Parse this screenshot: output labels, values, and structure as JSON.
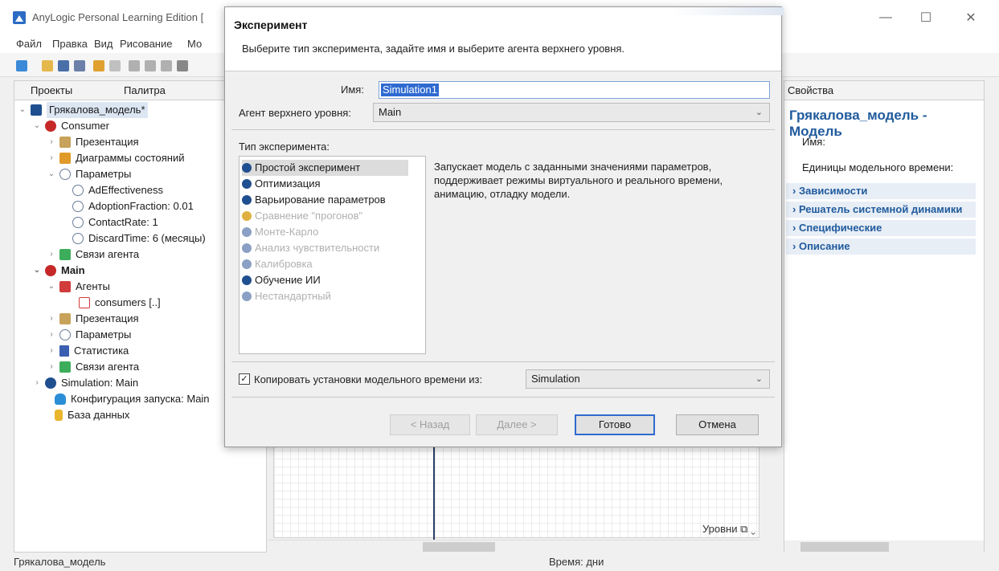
{
  "window": {
    "title": "AnyLogic Personal Learning Edition ["
  },
  "menu": [
    "Файл",
    "Правка",
    "Вид",
    "Рисование",
    "Мо"
  ],
  "left_panel": {
    "tabs": [
      "Проекты",
      "Палитра"
    ],
    "tree": [
      "Грякалова_модель*",
      "Consumer",
      "Презентация",
      "Диаграммы состояний",
      "Параметры",
      "AdEffectiveness",
      "AdoptionFraction: 0.01",
      "ContactRate: 1",
      "DiscardTime: 6 (месяцы)",
      "Связи агента",
      "Main",
      "Агенты",
      "consumers [..]",
      "Презентация",
      "Параметры",
      "Статистика",
      "Связи агента",
      "Simulation: Main",
      "Конфигурация запуска: Main",
      "База данных"
    ]
  },
  "canvas": {
    "levels_label": "Уровни"
  },
  "status": {
    "left": "Грякалова_модель",
    "time": "Время: дни"
  },
  "right_panel": {
    "tab": "Свойства",
    "title": "Грякалова_модель - Модель",
    "fields": [
      "Имя:",
      "Единицы модельного времени:"
    ],
    "sections": [
      "Зависимости",
      "Решатель системной динамики",
      "Специфические",
      "Описание"
    ]
  },
  "dialog": {
    "title": "Эксперимент",
    "subtitle": "Выберите тип эксперимента, задайте имя и выберите агента верхнего уровня.",
    "name_label": "Имя:",
    "name_value": "Simulation1",
    "agent_label": "Агент верхнего уровня:",
    "agent_value": "Main",
    "type_label": "Тип эксперимента:",
    "experiments": [
      "Простой эксперимент",
      "Оптимизация",
      "Варьирование параметров",
      "Сравнение \"прогонов\"",
      "Монте-Карло",
      "Анализ чувствительности",
      "Калибровка",
      "Обучение ИИ",
      "Нестандартный"
    ],
    "description": "Запускает модель с заданными значениями параметров, поддерживает режимы виртуального и реального времени, анимацию, отладку модели.",
    "copy_label": "Копировать установки модельного времени из:",
    "copy_value": "Simulation",
    "buttons": {
      "back": "< Назад",
      "next": "Далее >",
      "finish": "Готово",
      "cancel": "Отмена"
    }
  }
}
